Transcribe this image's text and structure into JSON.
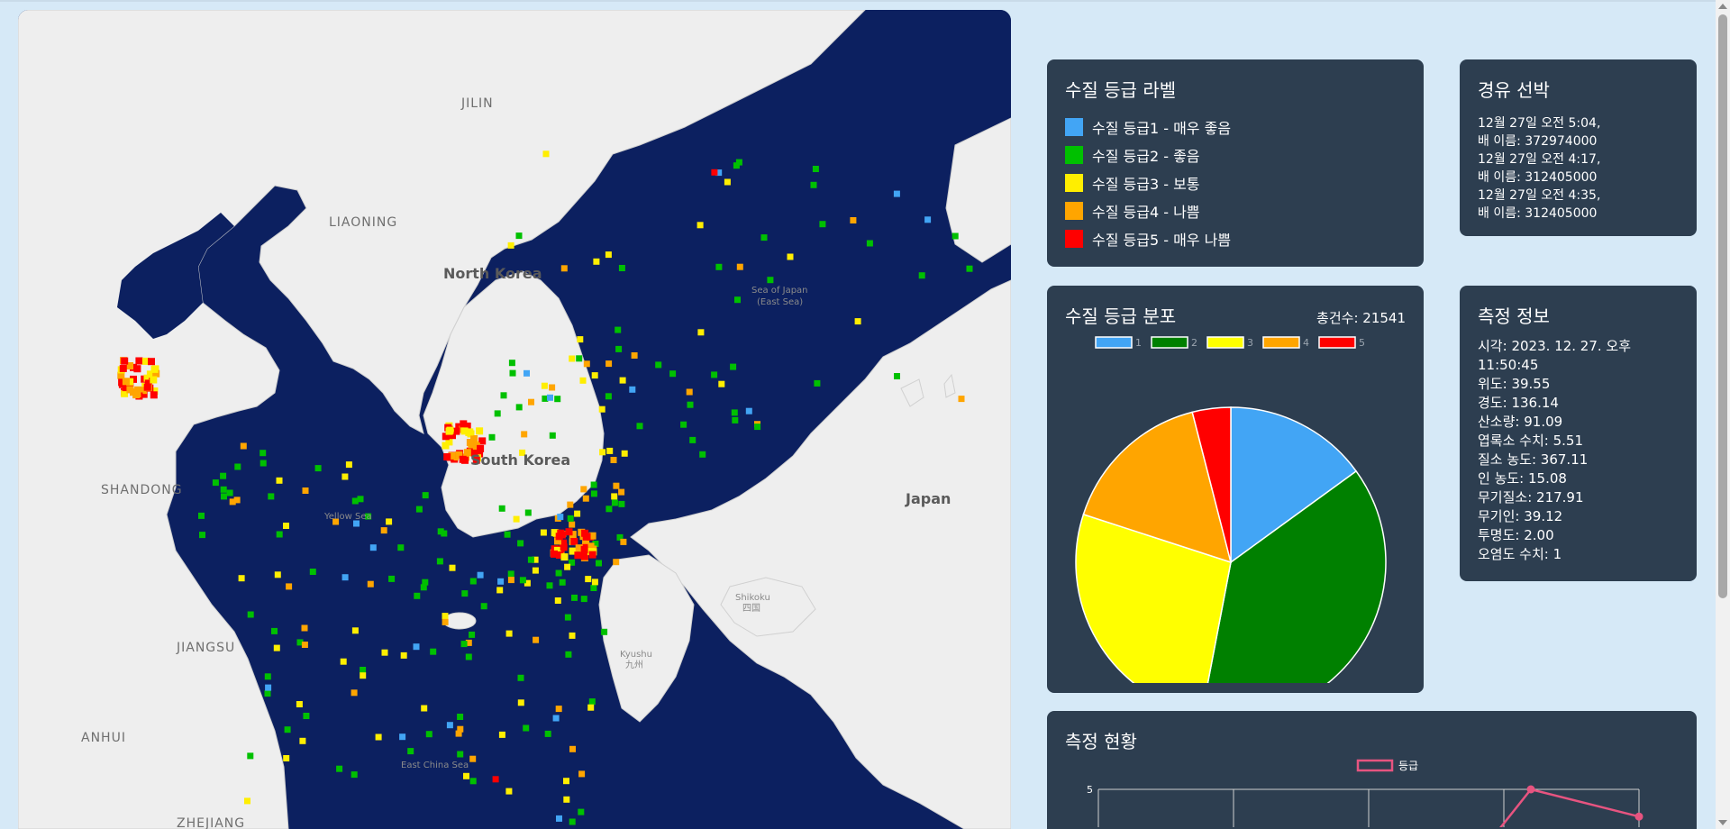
{
  "map": {
    "labels": {
      "jilin": "JILIN",
      "liaoning": "LIAONING",
      "north_korea": "North Korea",
      "sea_of_japan": "Sea of Japan",
      "east_sea": "(East Sea)",
      "shandong": "SHANDONG",
      "yellow_sea": "Yellow Sea",
      "south_korea": "South Korea",
      "japan": "Japan",
      "shikoku": "Shikoku",
      "shikoku_kanji": "四国",
      "kyushu": "Kyushu",
      "kyushu_kanji": "九州",
      "jiangsu": "JIANGSU",
      "anhui": "ANHUI",
      "east_china_sea": "East China Sea",
      "zhejiang": "ZHEJIANG"
    }
  },
  "legend": {
    "title": "수질 등급 라벨",
    "items": [
      {
        "label": "수질 등급1 - 매우 좋음",
        "color": "#42a5f5"
      },
      {
        "label": "수질 등급2 - 좋음",
        "color": "#00c000"
      },
      {
        "label": "수질 등급3 - 보통",
        "color": "#ffee00"
      },
      {
        "label": "수질 등급4 - 나쁨",
        "color": "#ffa500"
      },
      {
        "label": "수질 등급5 - 매우 나쁨",
        "color": "#ff0000"
      }
    ]
  },
  "ships": {
    "title": "경유 선박",
    "lines": [
      "12월 27일 오전 5:04,",
      "배 이름: 372974000",
      "12월 27일 오전 4:17,",
      "배 이름: 312405000",
      "12월 27일 오전 4:35,",
      "배 이름: 312405000"
    ]
  },
  "distribution": {
    "title": "수질 등급 분포",
    "total_label": "총건수",
    "total_value": "21541"
  },
  "info": {
    "title": "측정 정보",
    "rows": [
      {
        "k": "시각",
        "v": "2023. 12. 27. 오후 11:50:45"
      },
      {
        "k": "위도",
        "v": "39.55"
      },
      {
        "k": "경도",
        "v": "136.14"
      },
      {
        "k": "산소량",
        "v": "91.09"
      },
      {
        "k": "엽록소 수치",
        "v": "5.51"
      },
      {
        "k": "질소 농도",
        "v": "367.11"
      },
      {
        "k": "인 농도",
        "v": "15.08"
      },
      {
        "k": "무기질소",
        "v": "217.91"
      },
      {
        "k": "무기인",
        "v": "39.12"
      },
      {
        "k": "투명도",
        "v": "2.00"
      },
      {
        "k": "오염도 수치",
        "v": "1"
      }
    ]
  },
  "status": {
    "title": "측정 현황"
  },
  "chart_data": [
    {
      "type": "pie",
      "title": "수질 등급 분포",
      "categories": [
        "1",
        "2",
        "3",
        "4",
        "5"
      ],
      "values": [
        15,
        38,
        27,
        16,
        4
      ],
      "colors": [
        "#42a5f5",
        "#008000",
        "#ffff00",
        "#ffa500",
        "#ff0000"
      ],
      "legend": "top"
    },
    {
      "type": "line",
      "title": "측정 현황",
      "series": [
        {
          "name": "등급",
          "points": [
            [
              3.2,
              5
            ],
            [
              4,
              4.6
            ]
          ]
        }
      ],
      "x_lines": 4,
      "y_max_label": "5",
      "color": "#e75480",
      "legend": "top"
    }
  ]
}
